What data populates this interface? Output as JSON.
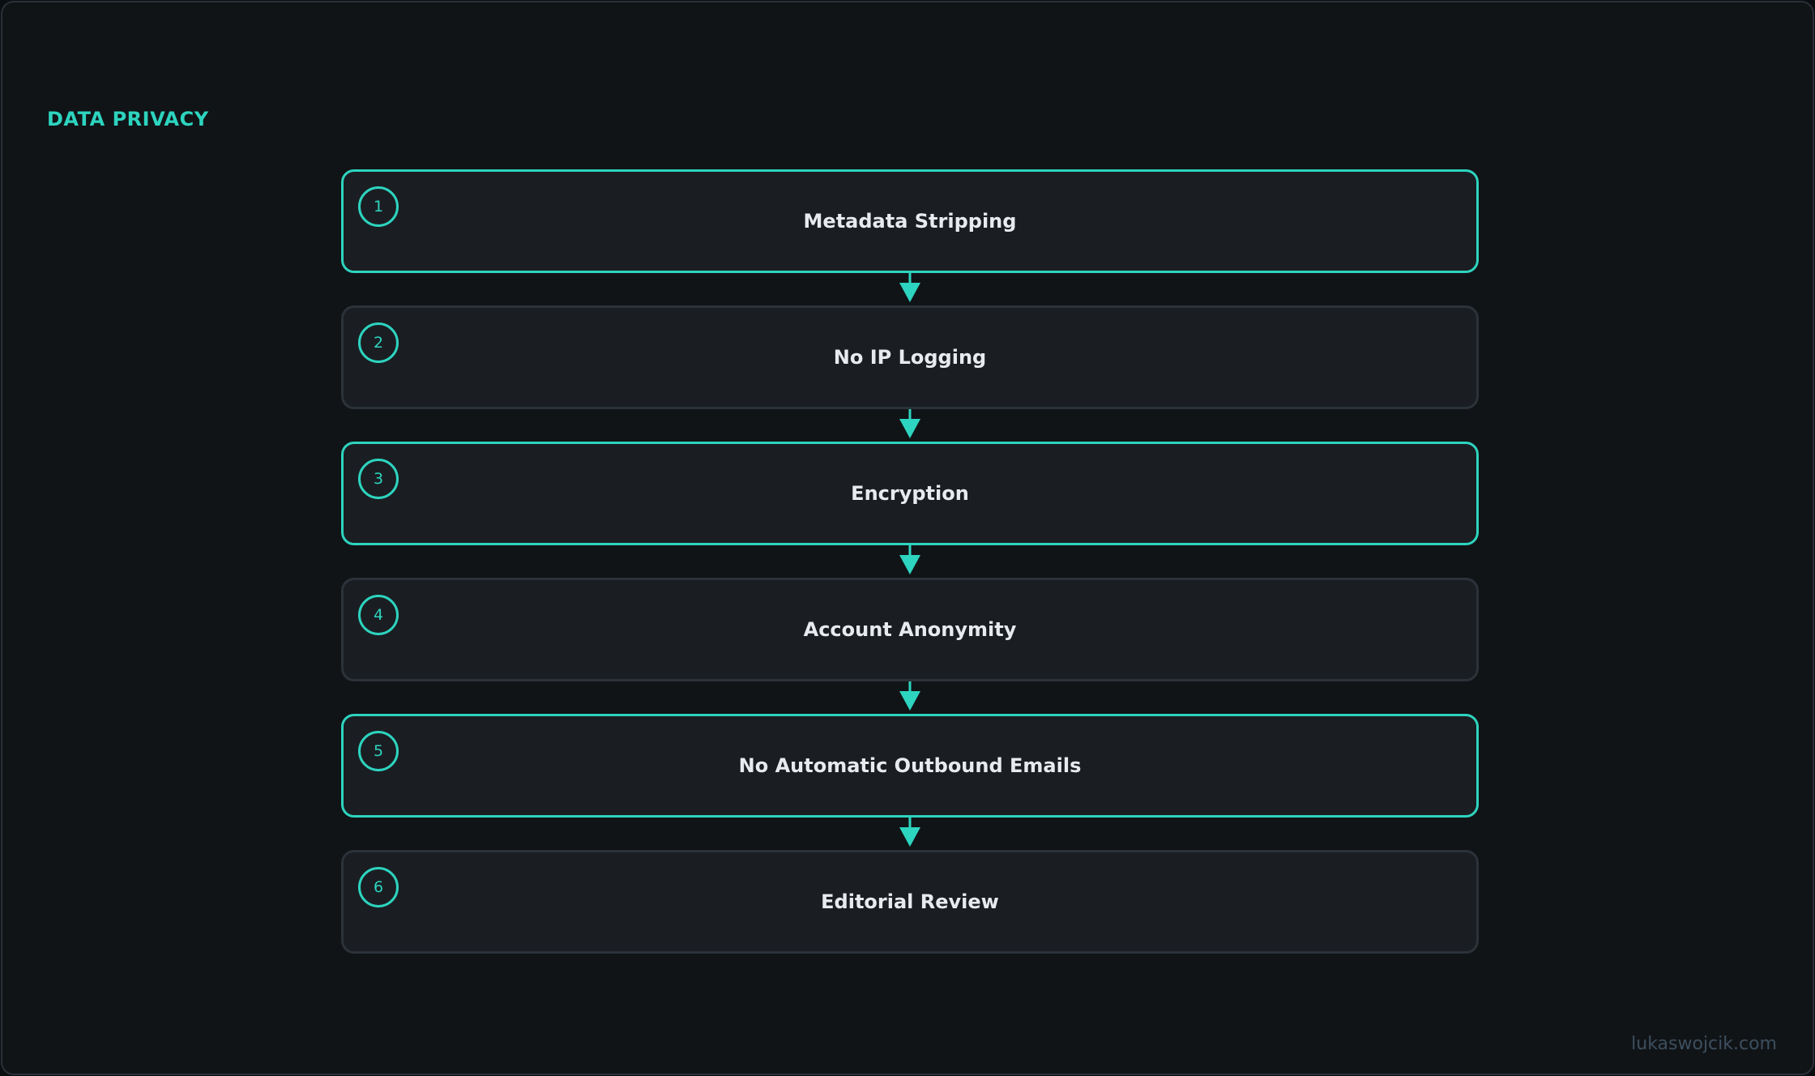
{
  "title": "DATA PRIVACY",
  "steps": [
    {
      "number": "1",
      "label": "Metadata Stripping",
      "highlighted": true
    },
    {
      "number": "2",
      "label": "No IP Logging",
      "highlighted": false
    },
    {
      "number": "3",
      "label": "Encryption",
      "highlighted": true
    },
    {
      "number": "4",
      "label": "Account Anonymity",
      "highlighted": false
    },
    {
      "number": "5",
      "label": "No Automatic Outbound Emails",
      "highlighted": true
    },
    {
      "number": "6",
      "label": "Editorial Review",
      "highlighted": false
    }
  ],
  "footer": "lukaswojcik.com",
  "colors": {
    "accent": "#2dd4bf",
    "background": "#111417",
    "card": "#1a1e22"
  },
  "icons": {
    "connector": "arrow-down-icon"
  }
}
